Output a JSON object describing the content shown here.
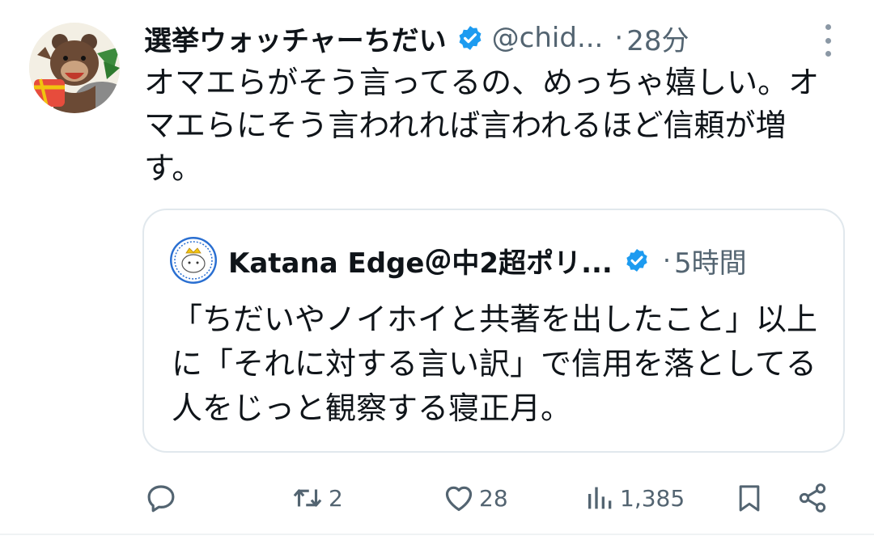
{
  "tweet": {
    "display_name": "選挙ウォッチャーちだい",
    "handle": "@chid...",
    "separator": "·",
    "time": "28分",
    "verified_icon": "verified-badge-icon",
    "avatar_icon": "bear-avatar",
    "text": "オマエらがそう言ってるの、めっちゃ嬉しい。オマエらにそう言われれば言われるほど信頼が増す。",
    "more_icon": "more-options-icon"
  },
  "quote": {
    "display_name": "Katana Edge＠中2超ポリ...",
    "separator": "·",
    "time": "5時間",
    "verified_icon": "verified-badge-icon",
    "avatar_icon": "cat-crown-avatar",
    "text": "「ちだいやノイホイと共著を出したこと」以上に「それに対する言い訳」で信用を落としてる人をじっと観察する寝正月。"
  },
  "actions": {
    "reply": {
      "icon": "reply-icon",
      "count": ""
    },
    "retweet": {
      "icon": "retweet-icon",
      "count": "2"
    },
    "like": {
      "icon": "heart-icon",
      "count": "28"
    },
    "views": {
      "icon": "views-icon",
      "count": "1,385"
    },
    "bookmark": {
      "icon": "bookmark-icon"
    },
    "share": {
      "icon": "share-icon"
    }
  },
  "colors": {
    "text": "#0f1419",
    "secondary": "#536471",
    "verified": "#1d9bf0",
    "border": "#e1e8ed"
  }
}
